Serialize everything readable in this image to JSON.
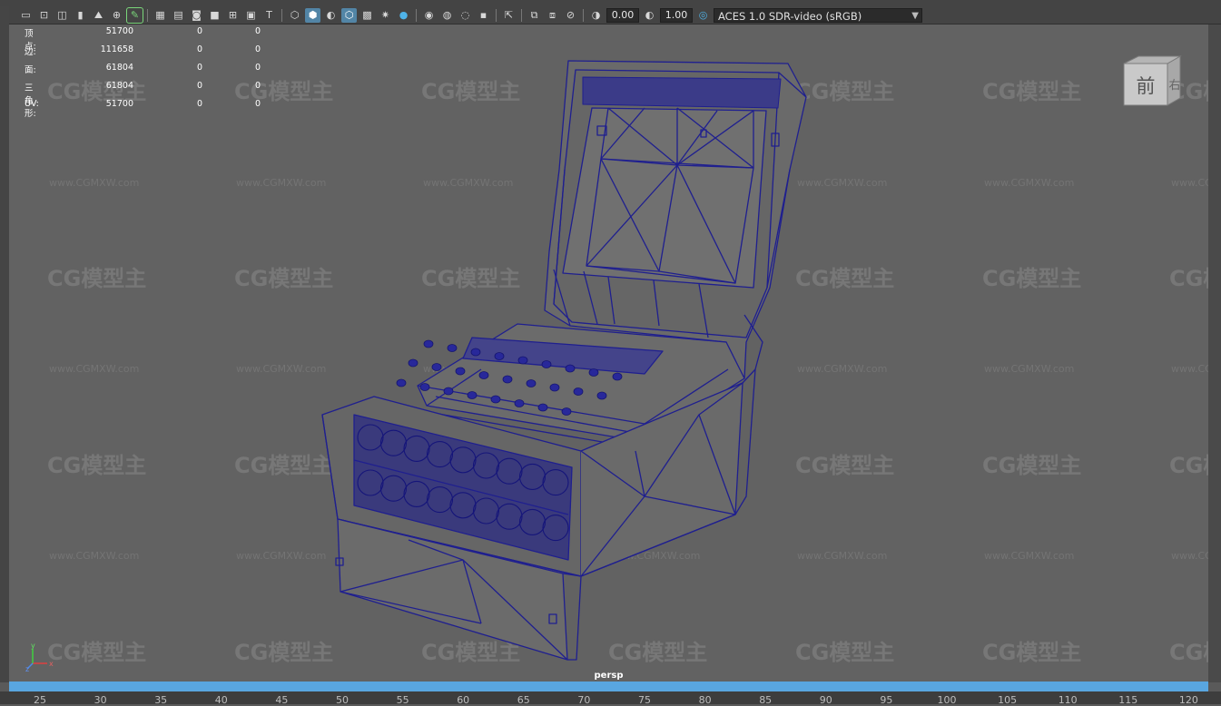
{
  "menu_fragment": "",
  "toolbar": {
    "icons": [
      "camera-icon",
      "camera-lock-icon",
      "camera-attributes-icon",
      "bookmark-icon",
      "image-plane-icon",
      "pencil-grease-icon",
      "grid-icon",
      "film-gate-icon",
      "resolution-gate-icon",
      "gate-mask-icon",
      "field-chart-icon",
      "safe-action-icon",
      "safe-title-icon",
      "wireframe-icon",
      "smooth-shade-icon",
      "use-default-material-icon",
      "wireframe-on-shaded-icon",
      "textured-icon",
      "lights-icon",
      "shadows-icon",
      "ambient-occlusion-icon",
      "motion-blur-icon",
      "anti-aliasing-icon",
      "depth-of-field-icon",
      "isolate-select-icon",
      "xray-icon",
      "xray-joints-icon",
      "xray-components-icon",
      "exposure-icon",
      "gamma-icon",
      "color-management-icon"
    ],
    "exposure_value": "0.00",
    "gamma_value": "1.00",
    "colorspace_selected": "ACES 1.0 SDR-video (sRGB)"
  },
  "hud": {
    "rows": [
      {
        "label": "顶点:",
        "v1": "51700",
        "v2": "0",
        "v3": "0"
      },
      {
        "label": "边:",
        "v1": "111658",
        "v2": "0",
        "v3": "0"
      },
      {
        "label": "面:",
        "v1": "61804",
        "v2": "0",
        "v3": "0"
      },
      {
        "label": "三角形:",
        "v1": "61804",
        "v2": "0",
        "v3": "0"
      },
      {
        "label": "UV:",
        "v1": "51700",
        "v2": "0",
        "v3": "0"
      }
    ]
  },
  "viewcube": {
    "front_label": "前",
    "right_label": "右"
  },
  "camera_label": "persp",
  "axis_labels": {
    "x": "x",
    "y": "y",
    "z": "z"
  },
  "watermark": {
    "logo_text": "CG模型主",
    "url_text": "www.CGMXW.com"
  },
  "timeline": {
    "ticks": [
      "25",
      "30",
      "35",
      "40",
      "45",
      "50",
      "55",
      "60",
      "65",
      "70",
      "75",
      "80",
      "85",
      "90",
      "95",
      "100",
      "105",
      "110",
      "115",
      "120"
    ]
  },
  "colors": {
    "accent": "#59a6e0",
    "wire": "#1f1f8f",
    "viewport_bg": "#626262",
    "active_button": "#5285a6"
  }
}
